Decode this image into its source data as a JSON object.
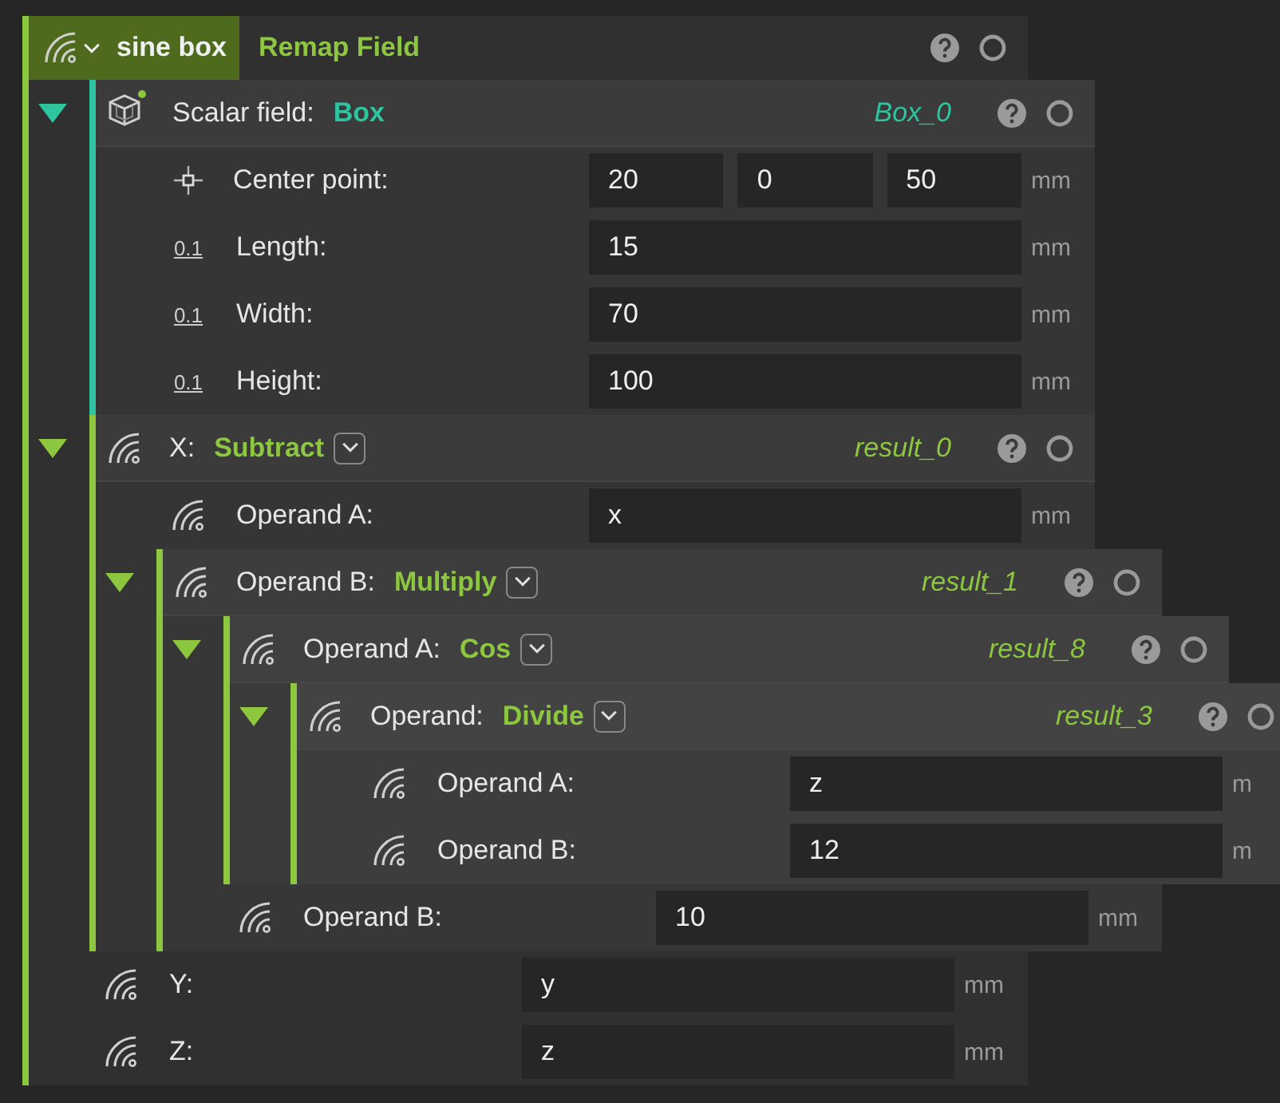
{
  "root": {
    "name": "sine box",
    "type": "Remap Field",
    "color": "#8dc63f",
    "children": [
      {
        "kind": "primitive",
        "label": "Scalar field:",
        "type": "Box",
        "output": "Box_0",
        "expanded": true,
        "color": "#2ec4a0",
        "children": [
          {
            "kind": "point",
            "label": "Center point:",
            "values": [
              "20",
              "0",
              "50"
            ],
            "unit": "mm"
          },
          {
            "kind": "number",
            "badge": "0.1",
            "label": "Length:",
            "values": [
              "15"
            ],
            "unit": "mm"
          },
          {
            "kind": "number",
            "badge": "0.1",
            "label": "Width:",
            "values": [
              "70"
            ],
            "unit": "mm"
          },
          {
            "kind": "number",
            "badge": "0.1",
            "label": "Height:",
            "values": [
              "100"
            ],
            "unit": "mm"
          }
        ]
      },
      {
        "kind": "operation",
        "label": "X:",
        "type": "Subtract",
        "output": "result_0",
        "expanded": true,
        "dropdown": true,
        "color": "#8dc63f",
        "children": [
          {
            "kind": "expression",
            "label": "Operand A:",
            "values": [
              "x"
            ],
            "unit": "mm"
          },
          {
            "kind": "operation",
            "label": "Operand B:",
            "type": "Multiply",
            "output": "result_1",
            "expanded": true,
            "dropdown": true,
            "color": "#8dc63f",
            "children": [
              {
                "kind": "operation",
                "label": "Operand A:",
                "type": "Cos",
                "output": "result_8",
                "expanded": true,
                "dropdown": true,
                "color": "#8dc63f",
                "children": [
                  {
                    "kind": "operation",
                    "label": "Operand:",
                    "type": "Divide",
                    "output": "result_3",
                    "expanded": true,
                    "dropdown": true,
                    "color": "#8dc63f",
                    "children": [
                      {
                        "kind": "expression",
                        "label": "Operand A:",
                        "values": [
                          "z"
                        ],
                        "unit": "m"
                      },
                      {
                        "kind": "expression",
                        "label": "Operand B:",
                        "values": [
                          "12"
                        ],
                        "unit": "m"
                      }
                    ]
                  }
                ]
              },
              {
                "kind": "expression",
                "label": "Operand B:",
                "values": [
                  "10"
                ],
                "unit": "mm"
              }
            ]
          }
        ]
      },
      {
        "kind": "expression",
        "label": "Y:",
        "values": [
          "y"
        ],
        "unit": "mm"
      },
      {
        "kind": "expression",
        "label": "Z:",
        "values": [
          "z"
        ],
        "unit": "mm"
      }
    ]
  }
}
